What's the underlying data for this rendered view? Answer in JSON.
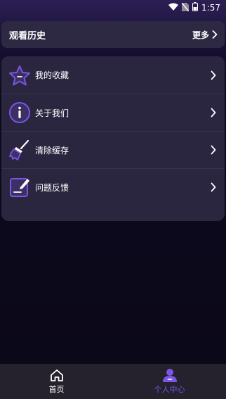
{
  "status_bar": {
    "time": "1:57",
    "icons": [
      "wifi-icon",
      "no-sim-icon",
      "battery-icon"
    ]
  },
  "history": {
    "title": "观看历史",
    "more_label": "更多"
  },
  "menu": {
    "items": [
      {
        "label": "我的收藏",
        "icon": "star-icon"
      },
      {
        "label": "关于我们",
        "icon": "info-icon"
      },
      {
        "label": "清除缓存",
        "icon": "broom-icon"
      },
      {
        "label": "问题反馈",
        "icon": "feedback-edit-icon"
      }
    ]
  },
  "tabbar": {
    "tabs": [
      {
        "label": "首页",
        "icon": "home-icon",
        "active": false
      },
      {
        "label": "个人中心",
        "icon": "person-icon",
        "active": true
      }
    ]
  },
  "colors": {
    "accent": "#7b55e6",
    "card": "#2b263f",
    "tabbar": "#25222d",
    "background": "#0b0819"
  }
}
